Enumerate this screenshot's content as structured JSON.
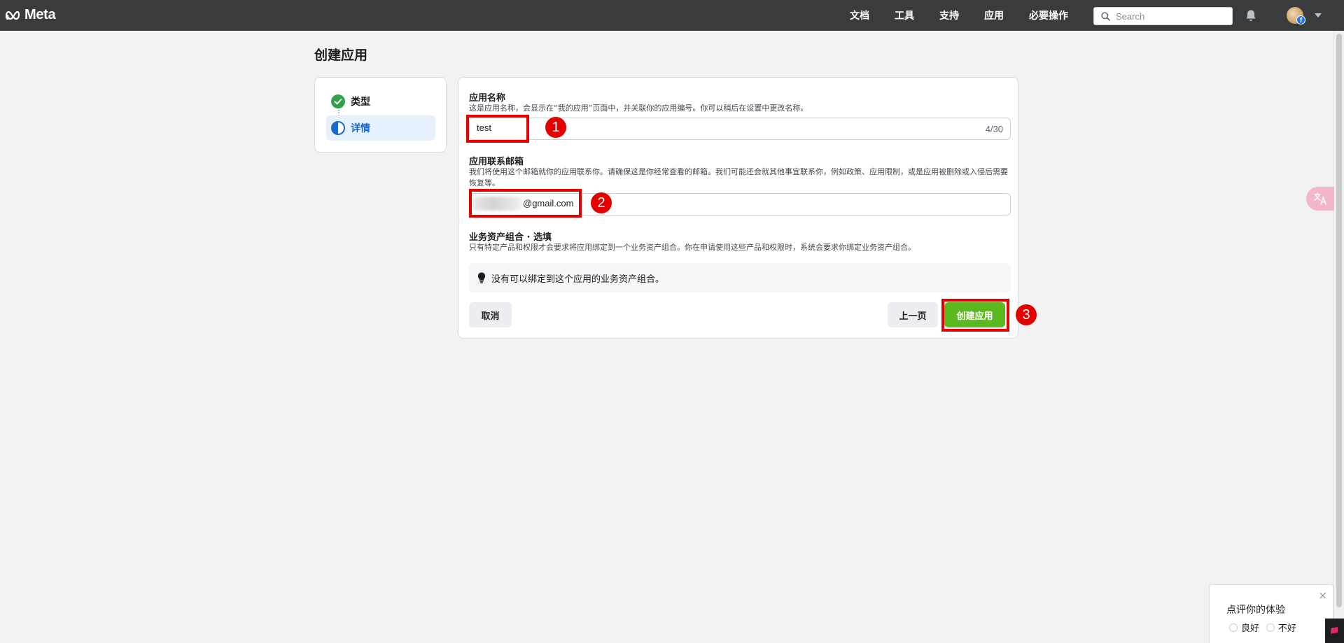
{
  "nav": {
    "logo": "Meta",
    "items": [
      "文档",
      "工具",
      "支持",
      "应用",
      "必要操作"
    ],
    "search_placeholder": "Search"
  },
  "page": {
    "title": "创建应用"
  },
  "steps": [
    {
      "label": "类型",
      "status": "complete"
    },
    {
      "label": "详情",
      "status": "in-progress"
    }
  ],
  "form": {
    "app_name": {
      "label": "应用名称",
      "description": "这是应用名称，会显示在“我的应用”页面中，并关联你的应用编号。你可以稍后在设置中更改名称。",
      "value": "test",
      "counter": "4/30"
    },
    "contact_email": {
      "label": "应用联系邮箱",
      "description": "我们将使用这个邮箱就你的应用联系你。请确保这是你经常查看的邮箱。我们可能还会就其他事宜联系你，例如政策、应用限制，或是应用被删除或入侵后需要恢复等。",
      "value": "@gmail.com"
    },
    "business_portfolio": {
      "label": "业务资产组合 · 选填",
      "description": "只有特定产品和权限才会要求将应用绑定到一个业务资产组合。你在申请使用这些产品和权限时，系统会要求你绑定业务资产组合。",
      "notice": "没有可以绑定到这个应用的业务资产组合。"
    },
    "buttons": {
      "cancel": "取消",
      "previous": "上一页",
      "create": "创建应用"
    }
  },
  "annotations": [
    "1",
    "2",
    "3"
  ],
  "feedback": {
    "title": "点评你的体验",
    "options": [
      "良好",
      "不好"
    ],
    "close": "×"
  },
  "colors": {
    "nav_bg": "#3a3b3c",
    "accent_blue": "#1b6ac9",
    "create_green": "#5cb81f",
    "annotation_red": "#e50000",
    "success_green": "#31a24c"
  }
}
